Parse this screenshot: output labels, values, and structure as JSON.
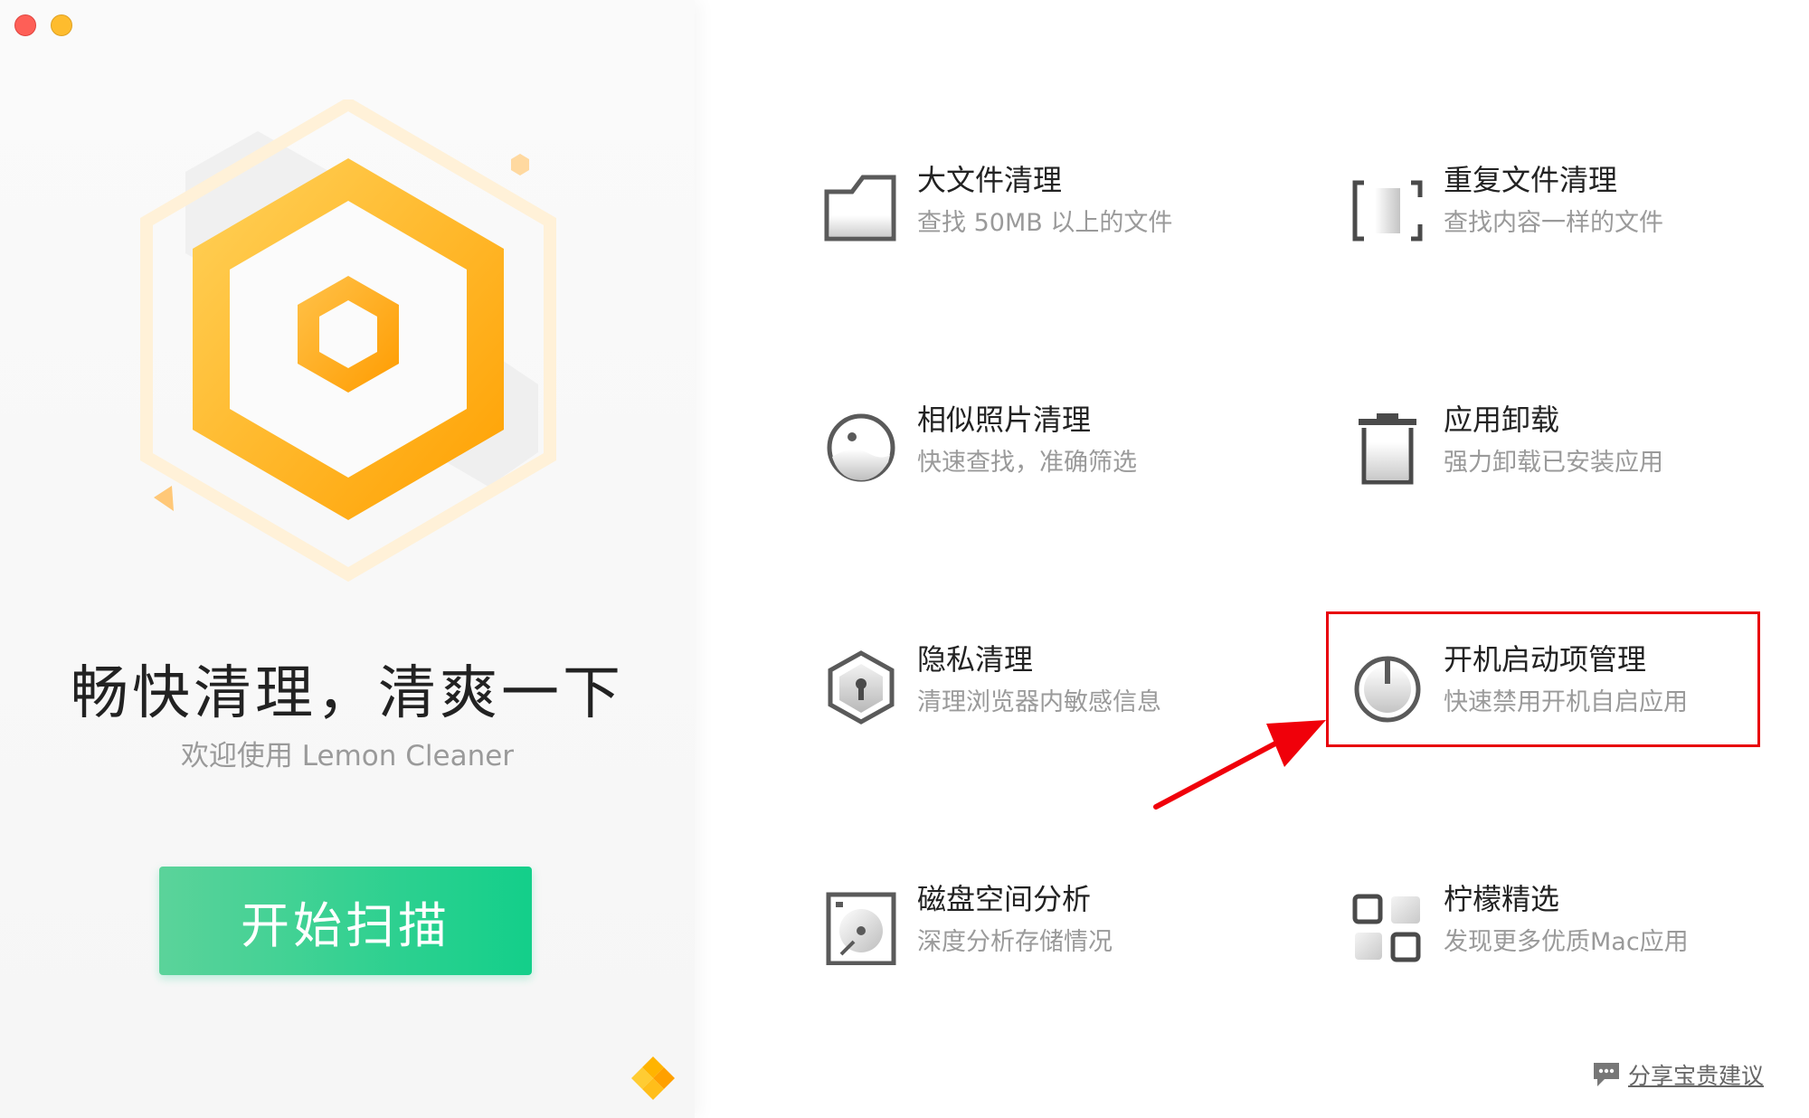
{
  "window": {
    "controls": [
      "close",
      "minimize"
    ]
  },
  "left_panel": {
    "headline": "畅快清理，清爽一下",
    "subtitle": "欢迎使用 Lemon Cleaner",
    "scan_button": "开始扫描",
    "logo_icon": "lemon-hexagon-logo",
    "brand_icon": "diamond-cluster-icon"
  },
  "features": [
    {
      "title": "大文件清理",
      "desc": "查找 50MB 以上的文件",
      "icon": "folder-icon"
    },
    {
      "title": "重复文件清理",
      "desc": "查找内容一样的文件",
      "icon": "duplicate-bracket-icon"
    },
    {
      "title": "相似照片清理",
      "desc": "快速查找，准确筛选",
      "icon": "photo-circle-icon"
    },
    {
      "title": "应用卸载",
      "desc": "强力卸载已安装应用",
      "icon": "trash-icon"
    },
    {
      "title": "隐私清理",
      "desc": "清理浏览器内敏感信息",
      "icon": "privacy-lock-icon"
    },
    {
      "title": "开机启动项管理",
      "desc": "快速禁用开机自启应用",
      "icon": "power-icon"
    },
    {
      "title": "磁盘空间分析",
      "desc": "深度分析存储情况",
      "icon": "disk-icon"
    },
    {
      "title": "柠檬精选",
      "desc": "发现更多优质Mac应用",
      "icon": "app-grid-icon"
    }
  ],
  "annotation": {
    "highlight_color": "#e8000b",
    "highlighted_feature": "开机启动项管理"
  },
  "feedback": {
    "label": "分享宝贵建议",
    "icon": "chat-bubble-icon"
  },
  "colors": {
    "accent_orange": "#ffa800",
    "scan_green": "#13cf8a"
  }
}
